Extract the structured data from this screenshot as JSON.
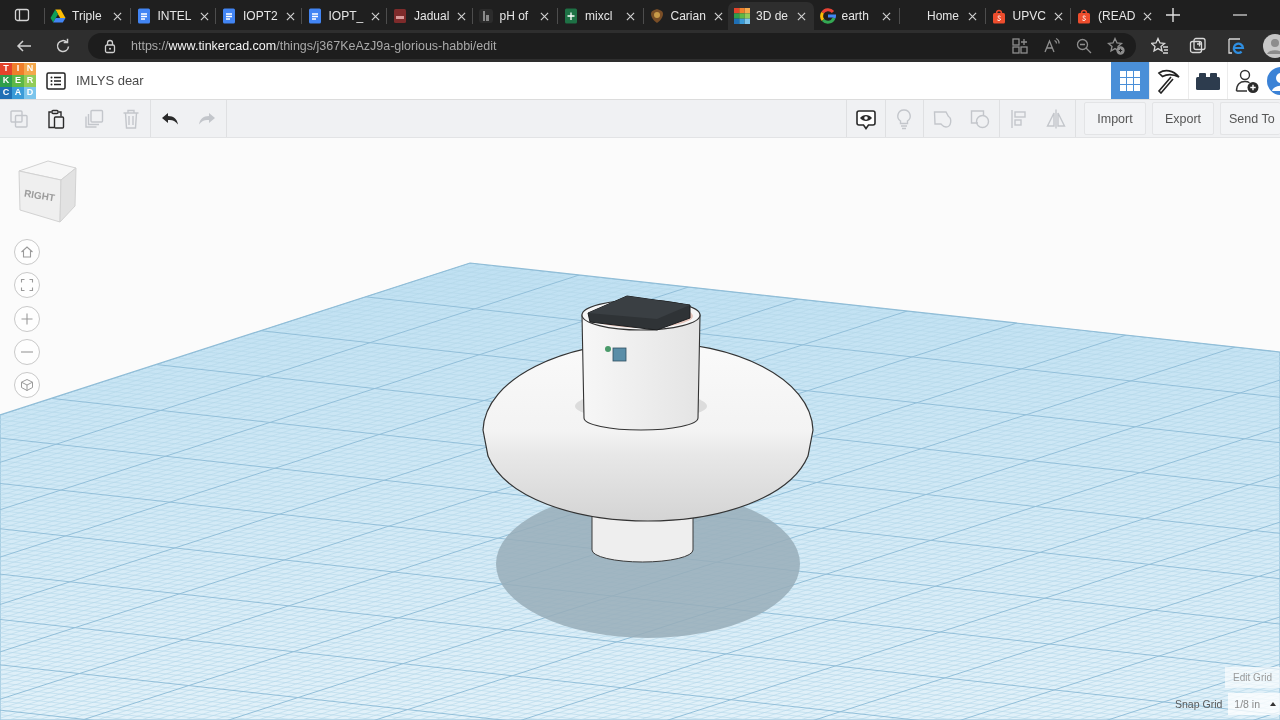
{
  "browser": {
    "tabs": [
      {
        "title": "Triple",
        "kind": "triangle",
        "selected": false
      },
      {
        "title": "INTEL",
        "kind": "doc",
        "selected": false
      },
      {
        "title": "IOPT2",
        "kind": "doc",
        "selected": false
      },
      {
        "title": "IOPT_",
        "kind": "doc",
        "selected": false
      },
      {
        "title": "Jadual",
        "kind": "pdf",
        "selected": false
      },
      {
        "title": "pH of",
        "kind": "bars",
        "selected": false
      },
      {
        "title": "mixcl",
        "kind": "sheet",
        "selected": false
      },
      {
        "title": "Carian",
        "kind": "crest",
        "selected": false
      },
      {
        "title": "3D de",
        "kind": "blocks",
        "selected": true
      },
      {
        "title": "earth",
        "kind": "ring",
        "selected": false
      },
      {
        "title": "Home",
        "kind": "blank",
        "selected": false
      },
      {
        "title": "UPVC",
        "kind": "bag",
        "selected": false
      },
      {
        "title": "(READ",
        "kind": "bag",
        "selected": false
      }
    ],
    "url": "https://**www.tinkercad.com**/things/j367KeAzJ9a-glorious-habbi/edit"
  },
  "app": {
    "logo": {
      "tiles": [
        {
          "letter": "T",
          "color": "#e4432b"
        },
        {
          "letter": "I",
          "color": "#ef7f2b"
        },
        {
          "letter": "N",
          "color": "#f4a84c"
        },
        {
          "letter": "K",
          "color": "#2f9e4b"
        },
        {
          "letter": "E",
          "color": "#5db847"
        },
        {
          "letter": "R",
          "color": "#92cc58"
        },
        {
          "letter": "C",
          "color": "#1f6fb5"
        },
        {
          "letter": "A",
          "color": "#3a9bd8"
        },
        {
          "letter": "D",
          "color": "#7cc5ec"
        }
      ]
    },
    "title": "IMLYS dear",
    "view_modes": [
      {
        "kind": "grid",
        "selected": true
      },
      {
        "kind": "pickaxe",
        "selected": false
      },
      {
        "kind": "brick",
        "selected": false
      }
    ]
  },
  "toolbar": {
    "edit_tools": [
      {
        "kind": "copy",
        "disabled": true
      },
      {
        "kind": "paste",
        "disabled": false
      },
      {
        "kind": "duplicate",
        "disabled": true
      },
      {
        "kind": "delete",
        "disabled": true
      }
    ],
    "history": [
      {
        "kind": "undo",
        "disabled": false
      },
      {
        "kind": "redo",
        "disabled": true
      }
    ],
    "shape_tools": [
      {
        "kind": "notes",
        "disabled": false
      },
      {
        "kind": "light",
        "disabled": true
      },
      {
        "kind": "group",
        "disabled": true
      },
      {
        "kind": "hole",
        "disabled": true
      },
      {
        "kind": "align",
        "disabled": true
      },
      {
        "kind": "mirror",
        "disabled": true
      }
    ],
    "actions": [
      "Import",
      "Export",
      "Send To"
    ]
  },
  "workplane": {
    "view_cube": "RIGHT",
    "edit_grid": "Edit Grid",
    "snap_grid": {
      "label": "Snap Grid",
      "value": "1/8 in"
    }
  }
}
